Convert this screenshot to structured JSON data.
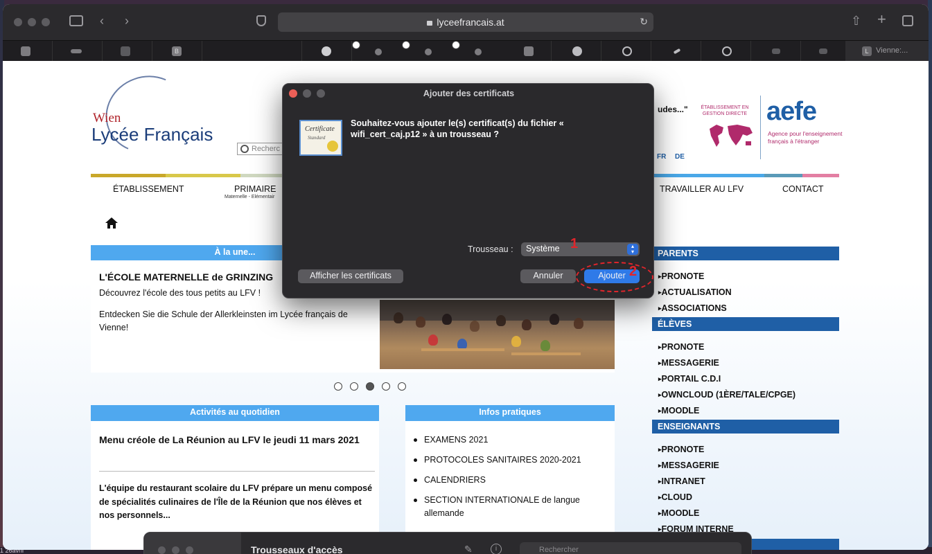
{
  "browser": {
    "url": "lyceefrancais.at",
    "last_tab_label": "Vienne:...",
    "last_tab_icon_letter": "L",
    "fav_b_letter": "B"
  },
  "site": {
    "logo_wien": "Wien",
    "logo_lycee": "Lycée Français",
    "search_placeholder": "Recherc",
    "nav": [
      {
        "label": "ÉTABLISSEMENT"
      },
      {
        "label": "PRIMAIRE",
        "sub": "Maternelle - Elémentair"
      },
      {
        "label": "TRAVAILLER AU LFV"
      },
      {
        "label": "CONTACT"
      }
    ],
    "nav_colors": [
      "#c9a82a",
      "#d8c84a",
      "#a9cd5a",
      "#cccccc",
      "#4aa8e8",
      "#5a9ab8",
      "#e37fa3"
    ],
    "etudes_text": "udes...\"",
    "lang_fr": "FR",
    "lang_de": "DE",
    "aefe_etab": "ÉTABLISSEMENT EN GESTION DIRECTE",
    "aefe_logo": "aefe",
    "aefe_sub": "Agence pour l'enseignement français à l'étranger",
    "une_header": "À la une...",
    "slide_title": "L'ÉCOLE MATERNELLE de GRINZING",
    "slide_text1": "Découvrez l'école des tous petits au LFV !",
    "slide_text2": "Entdecken Sie die Schule der Allerkleinsten im Lycée français de Vienne!",
    "carousel_active": 3,
    "activites_header": "Activités au quotidien",
    "menu_title": "Menu créole de La Réunion au LFV le jeudi 11 mars 2021",
    "menu_text": "L'équipe du restaurant scolaire du LFV prépare un menu composé de spécialités culinaires de l'Île de la Réunion que nos élèves et nos personnels...",
    "infos_header": "Infos pratiques",
    "infos": [
      "EXAMENS 2021",
      "PROTOCOLES SANITAIRES 2020-2021",
      "CALENDRIERS",
      "SECTION INTERNATIONALE de langue allemande"
    ],
    "parents_header": "PARENTS",
    "parents": [
      "PRONOTE",
      "ACTUALISATION",
      "ASSOCIATIONS"
    ],
    "eleves_header": "ÉLÈVES",
    "eleves": [
      "PRONOTE",
      "MESSAGERIE",
      "PORTAIL C.D.I",
      "OWNCLOUD (1ÈRE/TALE/CPGE)",
      "MOODLE"
    ],
    "enseignants_header": "ENSEIGNANTS",
    "enseignants": [
      "PRONOTE",
      "MESSAGERIE",
      "INTRANET",
      "CLOUD",
      "MOODLE",
      "FORUM INTERNE"
    ]
  },
  "dialog": {
    "title": "Ajouter des certificats",
    "cert_icon_title": "Certificate",
    "cert_icon_sub": "Standard",
    "message": "Souhaitez-vous ajouter le(s) certificat(s) du fichier « wifi_cert_caj.p12 » à un trousseau ?",
    "trousseau_label": "Trousseau :",
    "trousseau_value": "Système",
    "show_certs_button": "Afficher les certificats",
    "cancel_button": "Annuler",
    "add_button": "Ajouter",
    "annotation_1": "1",
    "annotation_2": "2",
    "colors": {
      "close": "#ec5f57",
      "inactive": "#5d5c60",
      "primary": "#2f7ae8",
      "annotation": "#e0252b"
    }
  },
  "keychain": {
    "title": "Trousseaux d'accès",
    "search_placeholder": "Rechercher"
  },
  "desktop": {
    "bottom_text": "1 26avril"
  }
}
